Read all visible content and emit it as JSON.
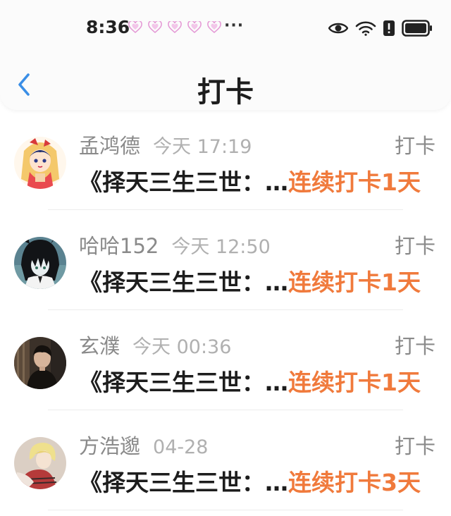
{
  "status_bar": {
    "time": "8:36",
    "extra": "···"
  },
  "header": {
    "title": "打卡"
  },
  "colors": {
    "accent_blue": "#3a8ee6",
    "streak_orange": "#f07a3c",
    "muted_gray": "#8a8a8a"
  },
  "items": [
    {
      "name": "孟鸿德",
      "time": "今天 17:19",
      "type": "打卡",
      "book": "《择天三生三世：…",
      "streak": "连续打卡1天",
      "avatar": "anime-girl-avatar"
    },
    {
      "name": "哈哈152",
      "time": "今天 12:50",
      "type": "打卡",
      "book": "《择天三生三世：…",
      "streak": "连续打卡1天",
      "avatar": "dark-hair-anime-avatar"
    },
    {
      "name": "玄濮",
      "time": "今天 00:36",
      "type": "打卡",
      "book": "《择天三生三世：…",
      "streak": "连续打卡1天",
      "avatar": "person-photo-avatar"
    },
    {
      "name": "方浩邈",
      "time": "04-28",
      "type": "打卡",
      "book": "《择天三生三世：…",
      "streak": "连续打卡3天",
      "avatar": "blonde-anime-avatar"
    }
  ]
}
